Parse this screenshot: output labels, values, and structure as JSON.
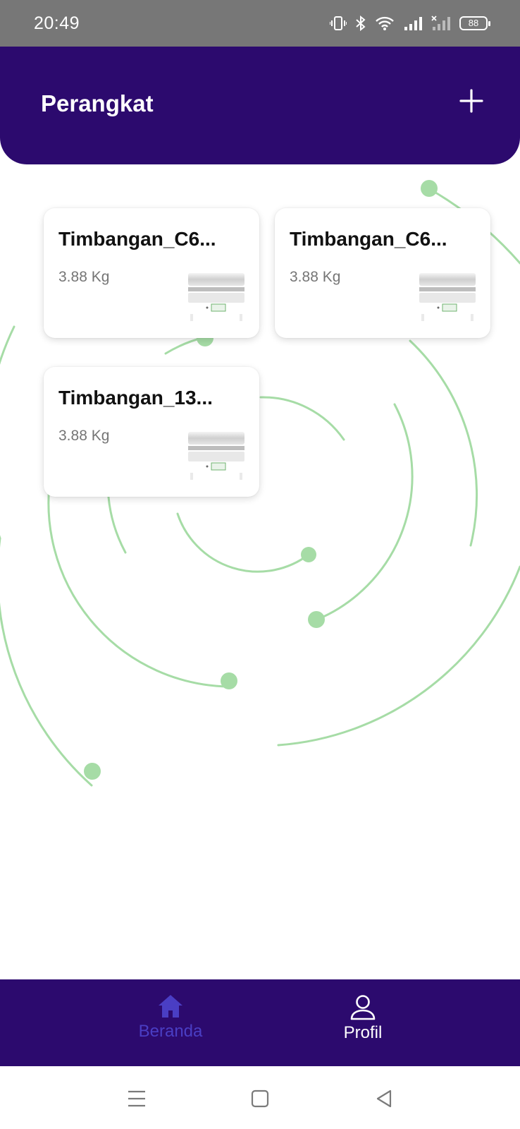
{
  "status_bar": {
    "time": "20:49",
    "battery": "88",
    "icons": [
      "vibrate-icon",
      "bluetooth-icon",
      "wifi-icon",
      "signal-icon",
      "signal-no-service-icon",
      "battery-icon"
    ]
  },
  "header": {
    "title": "Perangkat",
    "add_icon": "plus-icon"
  },
  "devices": [
    {
      "name": "Timbangan_C6...",
      "weight": "3.88 Kg",
      "image": "scale-image"
    },
    {
      "name": "Timbangan_C6...",
      "weight": "3.88 Kg",
      "image": "scale-image"
    },
    {
      "name": "Timbangan_13...",
      "weight": "3.88 Kg",
      "image": "scale-image"
    }
  ],
  "bottom_nav": {
    "items": [
      {
        "label": "Beranda",
        "icon": "home-icon",
        "active": true
      },
      {
        "label": "Profil",
        "icon": "user-icon",
        "active": false
      }
    ]
  },
  "system_nav": {
    "icons": [
      "menu-icon",
      "home-square-icon",
      "back-triangle-icon"
    ]
  },
  "colors": {
    "primary": "#2c0a6e",
    "accent_decoration": "#a6dca6",
    "active_nav": "#4a3ec4",
    "status_bar": "#777777"
  }
}
